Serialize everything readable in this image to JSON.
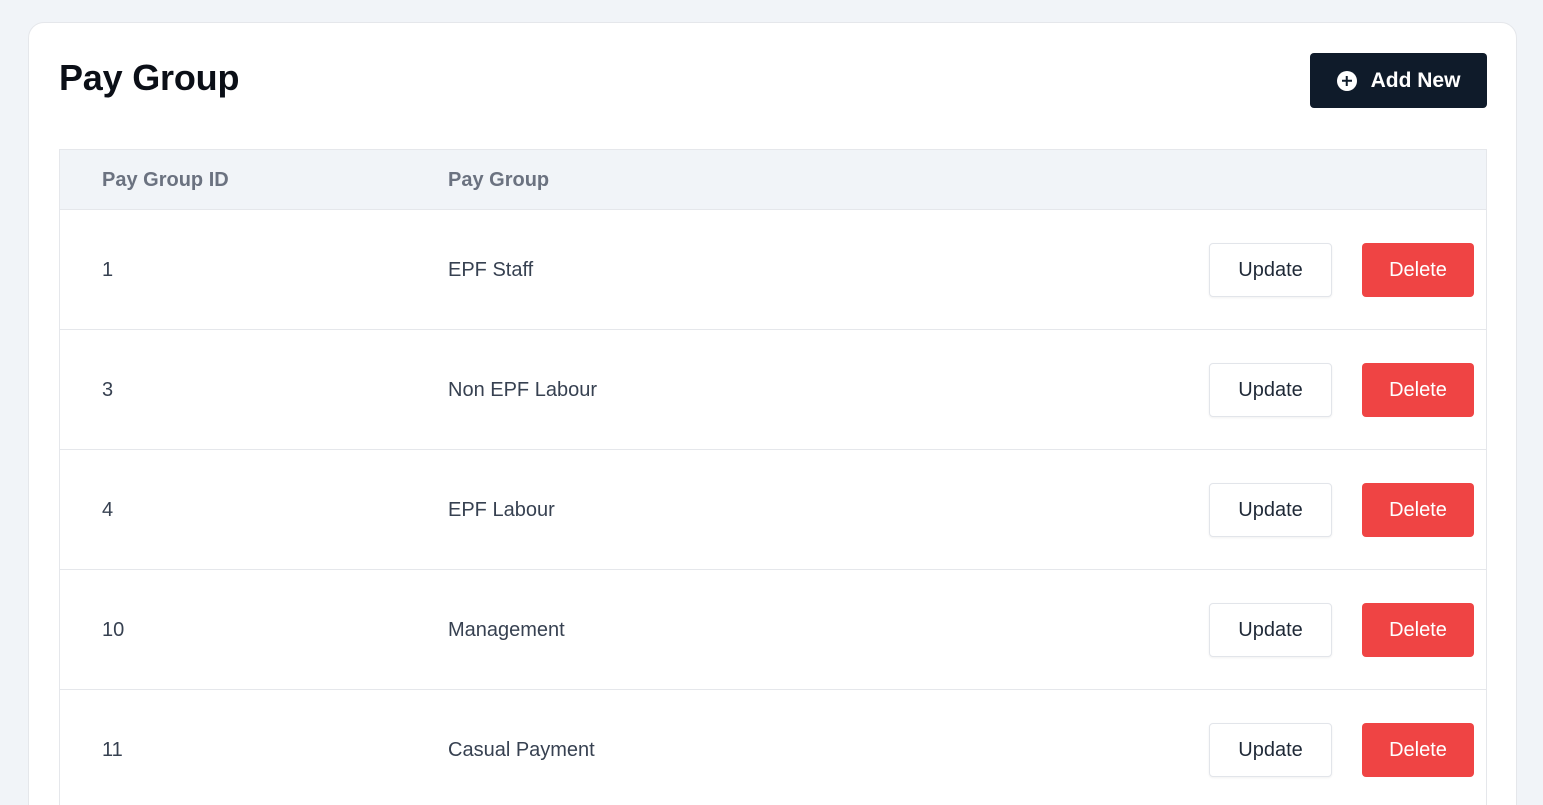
{
  "page": {
    "title": "Pay Group",
    "add_button_label": "Add New",
    "add_button_icon": "plus-circle-icon"
  },
  "table": {
    "headers": [
      "Pay Group ID",
      "Pay Group"
    ],
    "rows": [
      {
        "id": "1",
        "name": "EPF Staff"
      },
      {
        "id": "3",
        "name": "Non EPF Labour"
      },
      {
        "id": "4",
        "name": "EPF Labour"
      },
      {
        "id": "10",
        "name": "Management"
      },
      {
        "id": "11",
        "name": "Casual Payment"
      }
    ],
    "update_label": "Update",
    "delete_label": "Delete"
  },
  "colors": {
    "primary": "#0f1b2a",
    "danger": "#ef4444",
    "background": "#f1f4f8"
  }
}
